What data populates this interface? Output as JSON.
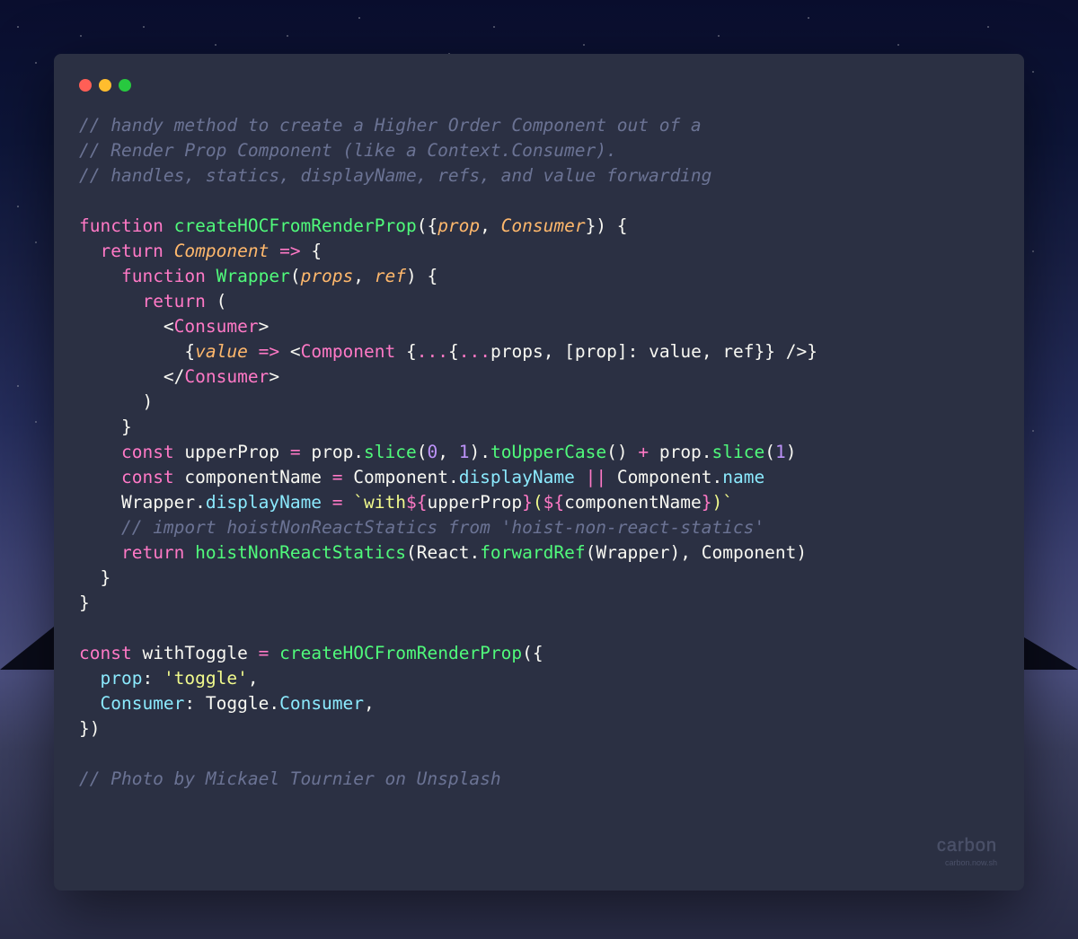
{
  "code": {
    "c1": "// handy method to create a Higher Order Component out of a",
    "c2": "// Render Prop Component (like a Context.Consumer).",
    "c3": "// handles, statics, displayName, refs, and value forwarding",
    "kw_function": "function",
    "fn_create": "createHOCFromRenderProp",
    "p_prop": "prop",
    "p_consumer": "Consumer",
    "kw_return": "return",
    "id_component": "Component",
    "arrow": "=>",
    "fn_wrapper": "Wrapper",
    "p_props": "props",
    "p_ref": "ref",
    "tag_consumer": "Consumer",
    "tag_component": "Component",
    "id_value": "value",
    "id_props": "props",
    "id_prop": "prop",
    "id_ref": "ref",
    "kw_const": "const",
    "id_upperProp": "upperProp",
    "m_slice": "slice",
    "n0": "0",
    "n1": "1",
    "m_toUpperCase": "toUpperCase",
    "id_componentName": "componentName",
    "m_displayName": "displayName",
    "m_name": "name",
    "id_wrapper": "Wrapper",
    "str_with": "`with",
    "tmpl_open": "${",
    "tmpl_close": "}",
    "str_paren_open": "(",
    "str_paren_close": ")`",
    "c4": "// import hoistNonReactStatics from 'hoist-non-react-statics'",
    "fn_hoist": "hoistNonReactStatics",
    "id_react": "React",
    "m_forwardRef": "forwardRef",
    "id_withToggle": "withToggle",
    "key_prop": "prop",
    "str_toggle": "'toggle'",
    "key_consumer": "Consumer",
    "id_toggle": "Toggle",
    "m_consumer": "Consumer",
    "c5": "// Photo by Mickael Tournier on Unsplash"
  },
  "watermark": {
    "title": "carbon",
    "sub": "carbon.now.sh"
  }
}
